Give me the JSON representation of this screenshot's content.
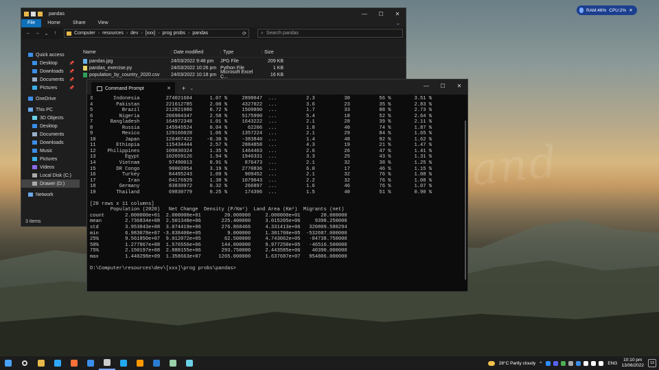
{
  "explorer": {
    "title": "pandas",
    "window_controls": [
      "—",
      "☐",
      "✕"
    ],
    "ribbon_tabs": [
      "File",
      "Home",
      "Share",
      "View"
    ],
    "ribbon_expand": "⌄",
    "nav": [
      "←",
      "→",
      "⌄",
      "↑"
    ],
    "breadcrumb": [
      "Computer",
      "resources",
      "dev",
      "[xxx]",
      "prog probs",
      "pandas"
    ],
    "search_placeholder": "Search pandas",
    "columns": {
      "name": "Name",
      "date": "Date modified",
      "type": "Type",
      "size": "Size"
    },
    "sidebar": [
      {
        "label": "Quick access",
        "level": "top",
        "pinned": false,
        "selected": false,
        "icon_color": "#3b8ee8"
      },
      {
        "label": "Desktop",
        "level": "l2",
        "pinned": true,
        "selected": false,
        "icon_color": "#3b8ee8"
      },
      {
        "label": "Downloads",
        "level": "l2",
        "pinned": true,
        "selected": false,
        "icon_color": "#3b8ee8"
      },
      {
        "label": "Documents",
        "level": "l2",
        "pinned": true,
        "selected": false,
        "icon_color": "#9ab0c8"
      },
      {
        "label": "Pictures",
        "level": "l2",
        "pinned": true,
        "selected": false,
        "icon_color": "#3bb0e8"
      },
      {
        "label": "",
        "level": "gap"
      },
      {
        "label": "OneDrive",
        "level": "top",
        "pinned": false,
        "selected": false,
        "icon_color": "#3b8ee8"
      },
      {
        "label": "",
        "level": "gap"
      },
      {
        "label": "This PC",
        "level": "top",
        "pinned": false,
        "selected": false,
        "icon_color": "#6aa8e8"
      },
      {
        "label": "3D Objects",
        "level": "l2",
        "pinned": false,
        "selected": false,
        "icon_color": "#6ad0e8"
      },
      {
        "label": "Desktop",
        "level": "l2",
        "pinned": false,
        "selected": false,
        "icon_color": "#3b8ee8"
      },
      {
        "label": "Documents",
        "level": "l2",
        "pinned": false,
        "selected": false,
        "icon_color": "#9ab0c8"
      },
      {
        "label": "Downloads",
        "level": "l2",
        "pinned": false,
        "selected": false,
        "icon_color": "#3b8ee8"
      },
      {
        "label": "Music",
        "level": "l2",
        "pinned": false,
        "selected": false,
        "icon_color": "#3b8ee8"
      },
      {
        "label": "Pictures",
        "level": "l2",
        "pinned": false,
        "selected": false,
        "icon_color": "#3bb0e8"
      },
      {
        "label": "Videos",
        "level": "l2",
        "pinned": false,
        "selected": false,
        "icon_color": "#8a6ae8"
      },
      {
        "label": "Local Disk (C:)",
        "level": "l2",
        "pinned": false,
        "selected": false,
        "icon_color": "#aaaaaa"
      },
      {
        "label": "Drawer (D:)",
        "level": "l2",
        "pinned": false,
        "selected": true,
        "icon_color": "#aaaaaa"
      },
      {
        "label": "",
        "level": "gap"
      },
      {
        "label": "Network",
        "level": "top",
        "pinned": false,
        "selected": false,
        "icon_color": "#6aa8e8"
      }
    ],
    "pin_glyph": "📌",
    "files": [
      {
        "name": "pandas.jpg",
        "date": "24/03/2022 9:48 pm",
        "type": "JPG File",
        "size": "209 KB",
        "icon_color": "#6ab0e8"
      },
      {
        "name": "pandas_exercise.py",
        "date": "24/03/2022 10:26 pm",
        "type": "Python File",
        "size": "1 KB",
        "icon_color": "#e8d36a"
      },
      {
        "name": "population_by_country_2020.csv",
        "date": "24/03/2022 10:18 pm",
        "type": "Microsoft Excel C...",
        "size": "16 KB",
        "icon_color": "#2e9e57"
      }
    ],
    "status": "3 items"
  },
  "terminal": {
    "tab_title": "Command Prompt",
    "close_glyph": "✕",
    "plus_glyph": "+",
    "dropdown_glyph": "⌄",
    "window_controls": [
      "—",
      "☐",
      "✕"
    ],
    "lines": [
      "3       Indonesia         274021604      1.07 %     2898047  ...          2.3          30          56 %        3.51 %",
      "4        Pakistan         221612785      2.00 %     4327022  ...          3.6          23          35 %        2.83 %",
      "5          Brazil         212821986      0.72 %     1509890  ...          1.7          33          88 %        2.73 %",
      "6         Nigeria         206984347      2.58 %     5175990  ...          5.4          18          52 %        2.64 %",
      "7      Bangladesh         164972348      1.01 %     1643222  ...          2.1          28          39 %        2.11 %",
      "8          Russia         145945524      0.04 %       62206  ...          1.8          40          74 %        1.87 %",
      "9          Mexico         129166028      1.06 %     1357224  ...          2.1          29          84 %        1.65 %",
      "10          Japan         126407422     -0.30 %     -383840  ...          1.4          48          92 %        1.62 %",
      "11       Ethiopia         115434444      2.57 %     2884858  ...          4.3          19          21 %        1.47 %",
      "12    Philippines         109830324      1.35 %     1464463  ...          2.6          26          47 %        1.41 %",
      "13          Egypt         102659126      1.94 %     1946331  ...          3.3          25          43 %        1.31 %",
      "14        Vietnam          97490013      0.91 %      876473  ...          2.1          32          38 %        1.25 %",
      "15       DR Congo          90003954      3.19 %     2770836  ...          6.0          17          46 %        1.15 %",
      "16         Turkey          84495243      1.09 %      909452  ...          2.1          32          76 %        1.08 %",
      "17           Iran          84176929      1.30 %     1079043  ...          2.2          32          76 %        1.08 %",
      "18        Germany          83830972      0.32 %      266897  ...          1.6          46          76 %        1.07 %",
      "19       Thailand          69830779      0.25 %      174396  ...          1.5          40          51 %        0.90 %",
      "",
      "[20 rows x 11 columns]",
      "       Population (2020)   Net Change  Density (P/Km²)  Land Area (Km²)  Migrants (net)",
      "count       2.000000e+01  2.000000e+01        20.000000     2.000000e+01       20.000000",
      "mean        2.736834e+08  2.501348e+06       225.400000     3.015205e+06     9398.250000",
      "std         3.953843e+08  3.074419e+06       276.868466     4.331413e+06   320809.580294",
      "min         6.983078e+07 -3.838400e+05         9.000000     1.301700e+05  -532687.000000",
      "25%         9.561850e+07  9.012072e+05        62.500000     4.743062e+05   -84738.750000",
      "50%         1.277867e+08  1.576556e+06       144.000000     9.977250e+05   -46516.500000",
      "75%         2.150197e+08  2.888155e+06       293.750000     2.443585e+06    40390.000000",
      "max         1.440298e+09  1.358663e+07      1265.000000     1.637687e+07   954806.000000",
      "",
      "D:\\Computer\\resources\\dev\\[xxx]\\prog probs\\pandas>"
    ]
  },
  "widget": {
    "ram": "RAM:46%",
    "cpu": "CPU:2%",
    "close_glyph": "✕"
  },
  "taskbar": {
    "apps": [
      {
        "name": "windows-start-icon",
        "color": "#4aa3ff"
      },
      {
        "name": "search-icon",
        "color": "#dddddd"
      },
      {
        "name": "file-explorer-icon",
        "color": "#e8b94a"
      },
      {
        "name": "photoshop-icon",
        "color": "#31a8ff"
      },
      {
        "name": "firefox-icon",
        "color": "#ff7139"
      },
      {
        "name": "firefox-developer-icon",
        "color": "#3b8ee8"
      },
      {
        "name": "terminal-icon",
        "color": "#cccccc"
      },
      {
        "name": "vscode-icon",
        "color": "#23a9f2"
      },
      {
        "name": "sublime-icon",
        "color": "#ff9800"
      },
      {
        "name": "word-icon",
        "color": "#2b7cd3"
      },
      {
        "name": "settings-app-icon",
        "color": "#9ad0a8"
      },
      {
        "name": "notepad-icon",
        "color": "#6ad0e8"
      }
    ],
    "weather": "28°C  Partly cloudy",
    "lang": "ENG",
    "time": "10:10 pm",
    "date": "13/06/2022",
    "notification_count": "13",
    "tray_icons": [
      {
        "name": "zoom-tray-icon",
        "color": "#2d8cff"
      },
      {
        "name": "discord-tray-icon",
        "color": "#5865f2"
      },
      {
        "name": "security-tray-icon",
        "color": "#4caf50"
      },
      {
        "name": "app-tray-icon",
        "color": "#aaaaaa"
      },
      {
        "name": "dropbox-tray-icon",
        "color": "#3b8ee8"
      },
      {
        "name": "onedrive-tray-icon",
        "color": "#ffffff"
      },
      {
        "name": "wifi-tray-icon",
        "color": "#ffffff"
      },
      {
        "name": "volume-tray-icon",
        "color": "#ffffff"
      }
    ],
    "tray_chevron": "^"
  }
}
